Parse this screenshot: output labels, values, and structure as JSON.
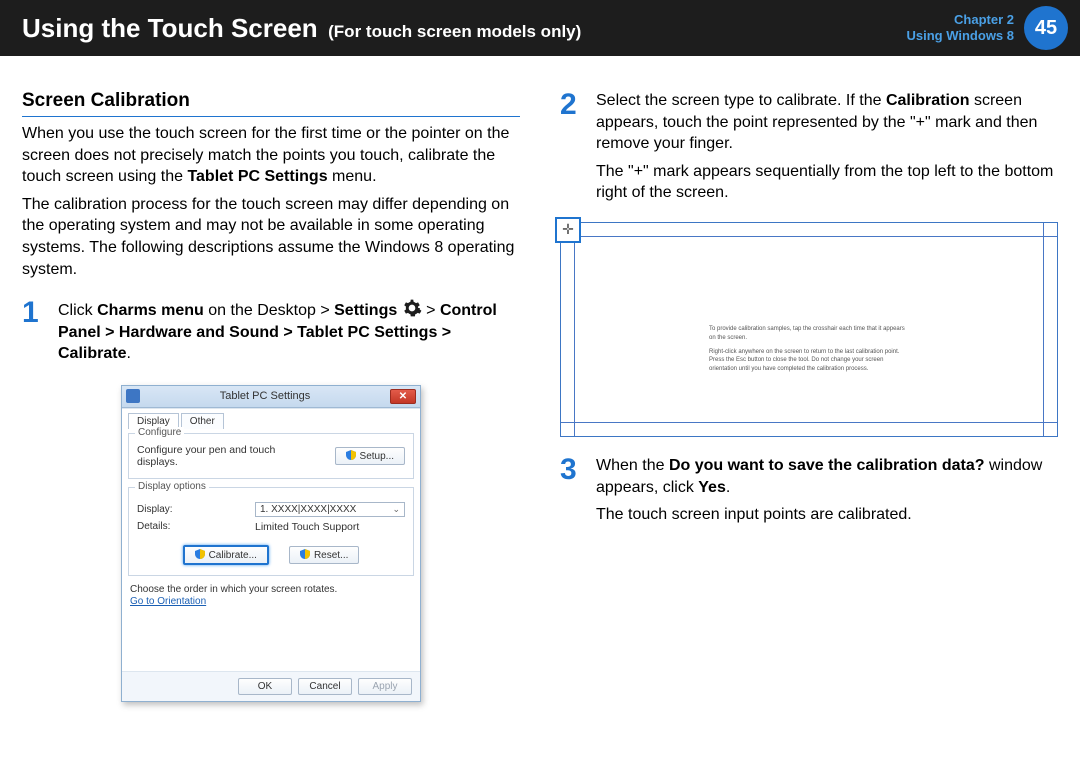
{
  "header": {
    "title": "Using the Touch Screen",
    "subtitle": "(For touch screen models only)",
    "chapter_line1": "Chapter 2",
    "chapter_line2": "Using Windows 8",
    "page_number": "45"
  },
  "section": {
    "heading": "Screen Calibration",
    "intro1": "When you use the touch screen for the first time or the pointer on the screen does not precisely match the points you touch, calibrate the touch screen using the ",
    "intro1_bold": "Tablet PC Settings",
    "intro1_after": " menu.",
    "intro2": "The calibration process for the touch screen may differ depending on the operating system and may not be available in some operating systems. The following descriptions assume the Windows 8 operating system."
  },
  "steps": {
    "s1": {
      "num": "1",
      "t1": "Click ",
      "b1": "Charms menu",
      "t2": " on the Desktop > ",
      "b2": "Settings",
      "t3": " > ",
      "b3": "Control Panel > Hardware and Sound > Tablet PC Settings > Calibrate",
      "t4": "."
    },
    "s2": {
      "num": "2",
      "t1": "Select the screen type to calibrate. If the ",
      "b1": "Calibration",
      "t2": " screen appears, touch the point represented by the \"+\" mark and then remove your finger.",
      "p2": "The \"+\" mark appears sequentially from the top left to the bottom right of the screen."
    },
    "s3": {
      "num": "3",
      "t1": "When the ",
      "b1": "Do you want to save the calibration data?",
      "t2": " window appears, click ",
      "b2": "Yes",
      "t3": ".",
      "p2": "The touch screen input points are calibrated."
    }
  },
  "dialog": {
    "title": "Tablet PC Settings",
    "tab_display": "Display",
    "tab_other": "Other",
    "configure_legend": "Configure",
    "configure_text": "Configure your pen and touch displays.",
    "setup_btn": "Setup...",
    "options_legend": "Display options",
    "display_label": "Display:",
    "display_value": "1. XXXX|XXXX|XXXX",
    "details_label": "Details:",
    "details_value": "Limited Touch Support",
    "calibrate_btn": "Calibrate...",
    "reset_btn": "Reset...",
    "rotate_text": "Choose the order in which your screen rotates.",
    "orientation_link": "Go to Orientation",
    "ok": "OK",
    "cancel": "Cancel",
    "apply": "Apply"
  },
  "calib": {
    "cross": "✛",
    "msg1": "To provide calibration samples, tap the crosshair each time that it appears on the screen.",
    "msg2": "Right-click anywhere on the screen to return to the last calibration point. Press the Esc button to close the tool. Do not change your screen orientation until you have completed the calibration process."
  }
}
